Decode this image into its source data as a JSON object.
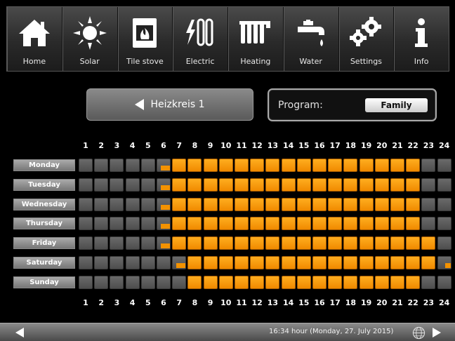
{
  "toolbar": [
    {
      "id": "home",
      "label": "Home",
      "icon": "home-icon"
    },
    {
      "id": "solar",
      "label": "Solar",
      "icon": "sun-icon"
    },
    {
      "id": "tile-stove",
      "label": "Tile stove",
      "icon": "stove-icon"
    },
    {
      "id": "electric",
      "label": "Electric",
      "icon": "heating-rod-icon"
    },
    {
      "id": "heating",
      "label": "Heating",
      "icon": "radiator-icon"
    },
    {
      "id": "water",
      "label": "Water",
      "icon": "faucet-icon"
    },
    {
      "id": "settings",
      "label": "Settings",
      "icon": "gears-icon"
    },
    {
      "id": "info",
      "label": "Info",
      "icon": "info-icon"
    }
  ],
  "circuit": {
    "label": "Heizkreis 1"
  },
  "program": {
    "label": "Program:",
    "value": "Family"
  },
  "hours": [
    "1",
    "2",
    "3",
    "4",
    "5",
    "6",
    "7",
    "8",
    "9",
    "10",
    "11",
    "12",
    "13",
    "14",
    "15",
    "16",
    "17",
    "18",
    "19",
    "20",
    "21",
    "22",
    "23",
    "24"
  ],
  "schedule": [
    {
      "day": "Monday",
      "slots": [
        0,
        0,
        0,
        0,
        0,
        "q34",
        1,
        1,
        1,
        1,
        1,
        1,
        1,
        1,
        1,
        1,
        1,
        1,
        1,
        1,
        1,
        1,
        0,
        0
      ]
    },
    {
      "day": "Tuesday",
      "slots": [
        0,
        0,
        0,
        0,
        0,
        "q34",
        1,
        1,
        1,
        1,
        1,
        1,
        1,
        1,
        1,
        1,
        1,
        1,
        1,
        1,
        1,
        1,
        0,
        0
      ]
    },
    {
      "day": "Wednesday",
      "slots": [
        0,
        0,
        0,
        0,
        0,
        "q34",
        1,
        1,
        1,
        1,
        1,
        1,
        1,
        1,
        1,
        1,
        1,
        1,
        1,
        1,
        1,
        1,
        0,
        0
      ]
    },
    {
      "day": "Thursday",
      "slots": [
        0,
        0,
        0,
        0,
        0,
        "q34",
        1,
        1,
        1,
        1,
        1,
        1,
        1,
        1,
        1,
        1,
        1,
        1,
        1,
        1,
        1,
        1,
        0,
        0
      ]
    },
    {
      "day": "Friday",
      "slots": [
        0,
        0,
        0,
        0,
        0,
        "q34",
        1,
        1,
        1,
        1,
        1,
        1,
        1,
        1,
        1,
        1,
        1,
        1,
        1,
        1,
        1,
        1,
        1,
        0
      ]
    },
    {
      "day": "Saturday",
      "slots": [
        0,
        0,
        0,
        0,
        0,
        0,
        "q34",
        1,
        1,
        1,
        1,
        1,
        1,
        1,
        1,
        1,
        1,
        1,
        1,
        1,
        1,
        1,
        1,
        "q12"
      ]
    },
    {
      "day": "Sunday",
      "slots": [
        0,
        0,
        0,
        0,
        0,
        0,
        0,
        1,
        1,
        1,
        1,
        1,
        1,
        1,
        1,
        1,
        1,
        1,
        1,
        1,
        1,
        1,
        0,
        0
      ]
    }
  ],
  "status": {
    "text": "16:34 hour (Monday, 27. July 2015)"
  },
  "colors": {
    "active": "#f39200",
    "inactive": "#5a5a5a",
    "background": "#000000"
  }
}
